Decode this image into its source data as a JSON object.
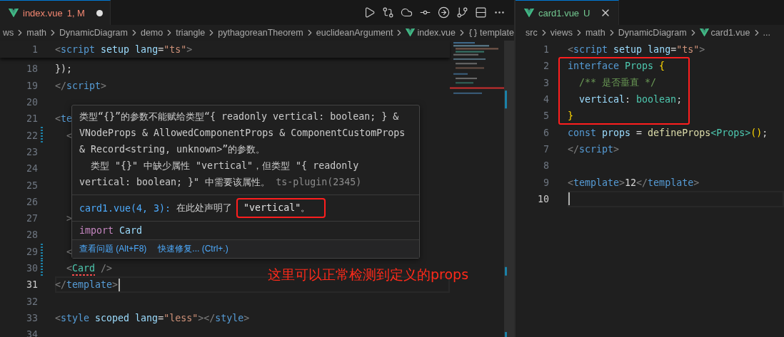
{
  "left_pane": {
    "tab": {
      "label": "index.vue",
      "badge": "1, M",
      "kind": "error",
      "modified": true,
      "selected": true
    },
    "actions": [
      {
        "kind": "play"
      },
      {
        "kind": "compare"
      },
      {
        "kind": "cloud"
      },
      {
        "kind": "commit"
      },
      {
        "kind": "circle-arrow"
      },
      {
        "kind": "branch-circle"
      },
      {
        "kind": "split"
      },
      {
        "kind": "more"
      }
    ],
    "breadcrumb": [
      {
        "kind": "folder",
        "label": "ws"
      },
      {
        "kind": "folder",
        "label": "math"
      },
      {
        "kind": "folder",
        "label": "DynamicDiagram"
      },
      {
        "kind": "folder",
        "label": "demo"
      },
      {
        "kind": "folder",
        "label": "triangle"
      },
      {
        "kind": "folder",
        "label": "pythagoreanTheorem"
      },
      {
        "kind": "folder",
        "label": "euclideanArgument"
      },
      {
        "kind": "vue",
        "label": "index.vue"
      },
      {
        "kind": "symbol",
        "label": "template"
      }
    ],
    "sticky_line": {
      "number": "1",
      "tokens": [
        {
          "kind": "bracket",
          "text": "<"
        },
        {
          "kind": "tag",
          "text": "script"
        },
        {
          "kind": "attr",
          "text": " setup"
        },
        {
          "kind": "attr",
          "text": " lang"
        },
        {
          "kind": "punct",
          "text": "="
        },
        {
          "kind": "string",
          "text": "\"ts\""
        },
        {
          "kind": "bracket",
          "text": ">"
        }
      ]
    },
    "lines": [
      {
        "number": "18",
        "current": false,
        "modified": false,
        "tokens": [
          {
            "kind": "punct",
            "text": "});"
          }
        ]
      },
      {
        "number": "19",
        "current": false,
        "modified": false,
        "tokens": [
          {
            "kind": "bracket",
            "text": "</"
          },
          {
            "kind": "tag",
            "text": "script"
          },
          {
            "kind": "bracket",
            "text": ">"
          }
        ]
      },
      {
        "number": "20",
        "current": false,
        "modified": false
      },
      {
        "number": "21",
        "current": false,
        "modified": false,
        "tokens": [
          {
            "kind": "bracket",
            "text": "<"
          },
          {
            "kind": "tag",
            "text": "te"
          }
        ]
      },
      {
        "number": "22",
        "current": false,
        "modified": true,
        "tokens": [
          {
            "kind": "bracket",
            "text": "  <"
          }
        ]
      },
      {
        "number": "23",
        "current": false,
        "modified": false
      },
      {
        "number": "24",
        "current": false,
        "modified": false
      },
      {
        "number": "25",
        "current": false,
        "modified": false
      },
      {
        "number": "26",
        "current": false,
        "modified": false
      },
      {
        "number": "27",
        "current": false,
        "modified": false,
        "tokens": [
          {
            "kind": "bracket",
            "text": "  >"
          }
        ]
      },
      {
        "number": "28",
        "current": false,
        "modified": false
      },
      {
        "number": "29",
        "current": false,
        "modified": true,
        "tokens": [
          {
            "kind": "bracket",
            "text": "  <"
          }
        ]
      },
      {
        "number": "30",
        "current": false,
        "modified": true,
        "tokens": [
          {
            "kind": "bracket",
            "text": "  <"
          },
          {
            "kind": "component",
            "text": "Card",
            "error": true
          },
          {
            "kind": "bracket",
            "text": " />"
          }
        ]
      },
      {
        "number": "31",
        "current": true,
        "modified": false,
        "tokens": [
          {
            "kind": "bracket",
            "text": "</"
          },
          {
            "kind": "tag",
            "text": "template"
          },
          {
            "kind": "bracket",
            "text": ">"
          }
        ]
      },
      {
        "number": "32",
        "current": false,
        "modified": false
      },
      {
        "number": "33",
        "current": false,
        "modified": false,
        "tokens": [
          {
            "kind": "bracket",
            "text": "<"
          },
          {
            "kind": "tag",
            "text": "style"
          },
          {
            "kind": "attr",
            "text": " scoped"
          },
          {
            "kind": "attr",
            "text": " lang"
          },
          {
            "kind": "punct",
            "text": "="
          },
          {
            "kind": "string",
            "text": "\"less\""
          },
          {
            "kind": "bracket",
            "text": "></"
          },
          {
            "kind": "tag",
            "text": "style"
          },
          {
            "kind": "bracket",
            "text": ">"
          }
        ]
      },
      {
        "number": "34",
        "current": false,
        "modified": false
      }
    ],
    "hover": {
      "message": "类型“{}”的参数不能赋给类型“{ readonly vertical: boolean; } & VNodeProps & AllowedComponentProps & ComponentCustomProps & Record<string, unknown>”的参数。",
      "detail": "  类型 \"{}\" 中缺少属性 \"vertical\"，但类型 \"{ readonly vertical: boolean; }\" 中需要该属性。",
      "source": "ts-plugin(2345)",
      "related": {
        "link": "card1.vue(4, 3):",
        "text": "在此处声明了",
        "code": "\"vertical\"。",
        "framed": true
      },
      "code": [
        {
          "kind": "keyword-import",
          "text": "import"
        },
        {
          "kind": "variable",
          "text": " Card"
        }
      ],
      "actions": [
        "查看问题 (Alt+F8)",
        "快速修复... (Ctrl+.)"
      ]
    },
    "annotation": "这里可以正常检测到定义的props"
  },
  "right_pane": {
    "tab": {
      "label": "card1.vue",
      "badge": "U",
      "kind": "untracked",
      "modified": false,
      "selected": true
    },
    "breadcrumb": [
      {
        "kind": "folder",
        "label": "src"
      },
      {
        "kind": "folder",
        "label": "views"
      },
      {
        "kind": "folder",
        "label": "math"
      },
      {
        "kind": "folder",
        "label": "DynamicDiagram"
      },
      {
        "kind": "vue",
        "label": "card1.vue"
      },
      {
        "kind": "more",
        "label": "..."
      }
    ],
    "lines": [
      {
        "number": "1",
        "current": false,
        "framed": false,
        "tokens": [
          {
            "kind": "bracket",
            "text": "<"
          },
          {
            "kind": "tag",
            "text": "script"
          },
          {
            "kind": "attr",
            "text": " setup"
          },
          {
            "kind": "attr",
            "text": " lang"
          },
          {
            "kind": "punct",
            "text": "="
          },
          {
            "kind": "string",
            "text": "\"ts\""
          },
          {
            "kind": "bracket",
            "text": ">"
          }
        ]
      },
      {
        "number": "2",
        "current": false,
        "framed": true,
        "tokens": [
          {
            "kind": "keyword",
            "text": "interface"
          },
          {
            "kind": "type",
            "text": " Props"
          },
          {
            "kind": "brace",
            "text": " {"
          }
        ]
      },
      {
        "number": "3",
        "current": false,
        "framed": true,
        "tokens": [
          {
            "kind": "comment",
            "text": "  /** 是否垂直 */"
          }
        ]
      },
      {
        "number": "4",
        "current": false,
        "framed": true,
        "tokens": [
          {
            "kind": "attr",
            "text": "  vertical"
          },
          {
            "kind": "punct",
            "text": ": "
          },
          {
            "kind": "type",
            "text": "boolean"
          },
          {
            "kind": "punct",
            "text": ";"
          }
        ]
      },
      {
        "number": "5",
        "current": false,
        "framed": true,
        "tokens": [
          {
            "kind": "brace",
            "text": "}"
          }
        ]
      },
      {
        "number": "6",
        "current": false,
        "framed": false,
        "tokens": [
          {
            "kind": "keyword",
            "text": "const"
          },
          {
            "kind": "variable",
            "text": " props"
          },
          {
            "kind": "punct",
            "text": " = "
          },
          {
            "kind": "func",
            "text": "defineProps"
          },
          {
            "kind": "type",
            "text": "<Props>"
          },
          {
            "kind": "brace",
            "text": "()"
          },
          {
            "kind": "punct",
            "text": ";"
          }
        ]
      },
      {
        "number": "7",
        "current": false,
        "framed": false,
        "tokens": [
          {
            "kind": "bracket",
            "text": "</"
          },
          {
            "kind": "tag",
            "text": "script"
          },
          {
            "kind": "bracket",
            "text": ">"
          }
        ]
      },
      {
        "number": "8",
        "current": false,
        "framed": false
      },
      {
        "number": "9",
        "current": false,
        "framed": false,
        "tokens": [
          {
            "kind": "bracket",
            "text": "<"
          },
          {
            "kind": "tag",
            "text": "template"
          },
          {
            "kind": "bracket",
            "text": ">"
          },
          {
            "kind": "punct",
            "text": "12"
          },
          {
            "kind": "bracket",
            "text": "</"
          },
          {
            "kind": "tag",
            "text": "template"
          },
          {
            "kind": "bracket",
            "text": ">"
          }
        ]
      },
      {
        "number": "10",
        "current": true,
        "framed": false
      }
    ]
  }
}
